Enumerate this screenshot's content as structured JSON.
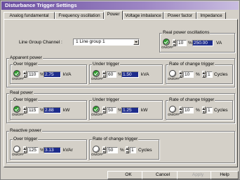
{
  "window": {
    "title": "Disturbance Trigger Settings"
  },
  "tabs": [
    {
      "label": "Analog fundamental"
    },
    {
      "label": "Frequency oscillation"
    },
    {
      "label": "Power"
    },
    {
      "label": "Voltage imbalance"
    },
    {
      "label": "Power factor"
    },
    {
      "label": "Impedance"
    }
  ],
  "active_tab": "Power",
  "line_group": {
    "label": "Line Group Channel :",
    "value": "1  Line group 1"
  },
  "onoff_label": "ON/OFF",
  "real_power_osc": {
    "title": "Real power oscillations",
    "percent": "10",
    "unit_pct": "%",
    "value": "250.00",
    "unit": "VA"
  },
  "apparent": {
    "title": "Apparent power",
    "over": {
      "title": "Over trigger",
      "percent": "110",
      "value": "2.75",
      "unit": "kVA"
    },
    "under": {
      "title": "Under trigger",
      "percent": "60",
      "value": "1.50",
      "unit": "kVA"
    },
    "rate": {
      "title": "Rate of change trigger",
      "percent": "10",
      "cycles": "1",
      "cycles_label": "Cycles"
    }
  },
  "real": {
    "title": "Real power",
    "over": {
      "title": "Over trigger",
      "percent": "115",
      "value": "2.88",
      "unit": "kW"
    },
    "under": {
      "title": "Under trigger",
      "percent": "50",
      "value": "1.25",
      "unit": "kW"
    },
    "rate": {
      "title": "Rate of change trigger",
      "percent": "10",
      "cycles": "1",
      "cycles_label": "Cycles"
    }
  },
  "reactive": {
    "title": "Reactive power",
    "over": {
      "title": "Over trigger",
      "percent": "125",
      "value": "3.13",
      "unit": "kVAr"
    },
    "rate": {
      "title": "Rate of change trigger",
      "percent": "50",
      "cycles": "1",
      "cycles_label": "Cycles"
    }
  },
  "pct": "%",
  "buttons": {
    "ok": "OK",
    "cancel": "Cancel",
    "apply": "Apply",
    "help": "Help"
  },
  "colors": {
    "title_bar": "#6b4fa0",
    "value_field": "#1d2c8c",
    "toggle_on": "#2f9e2f"
  }
}
